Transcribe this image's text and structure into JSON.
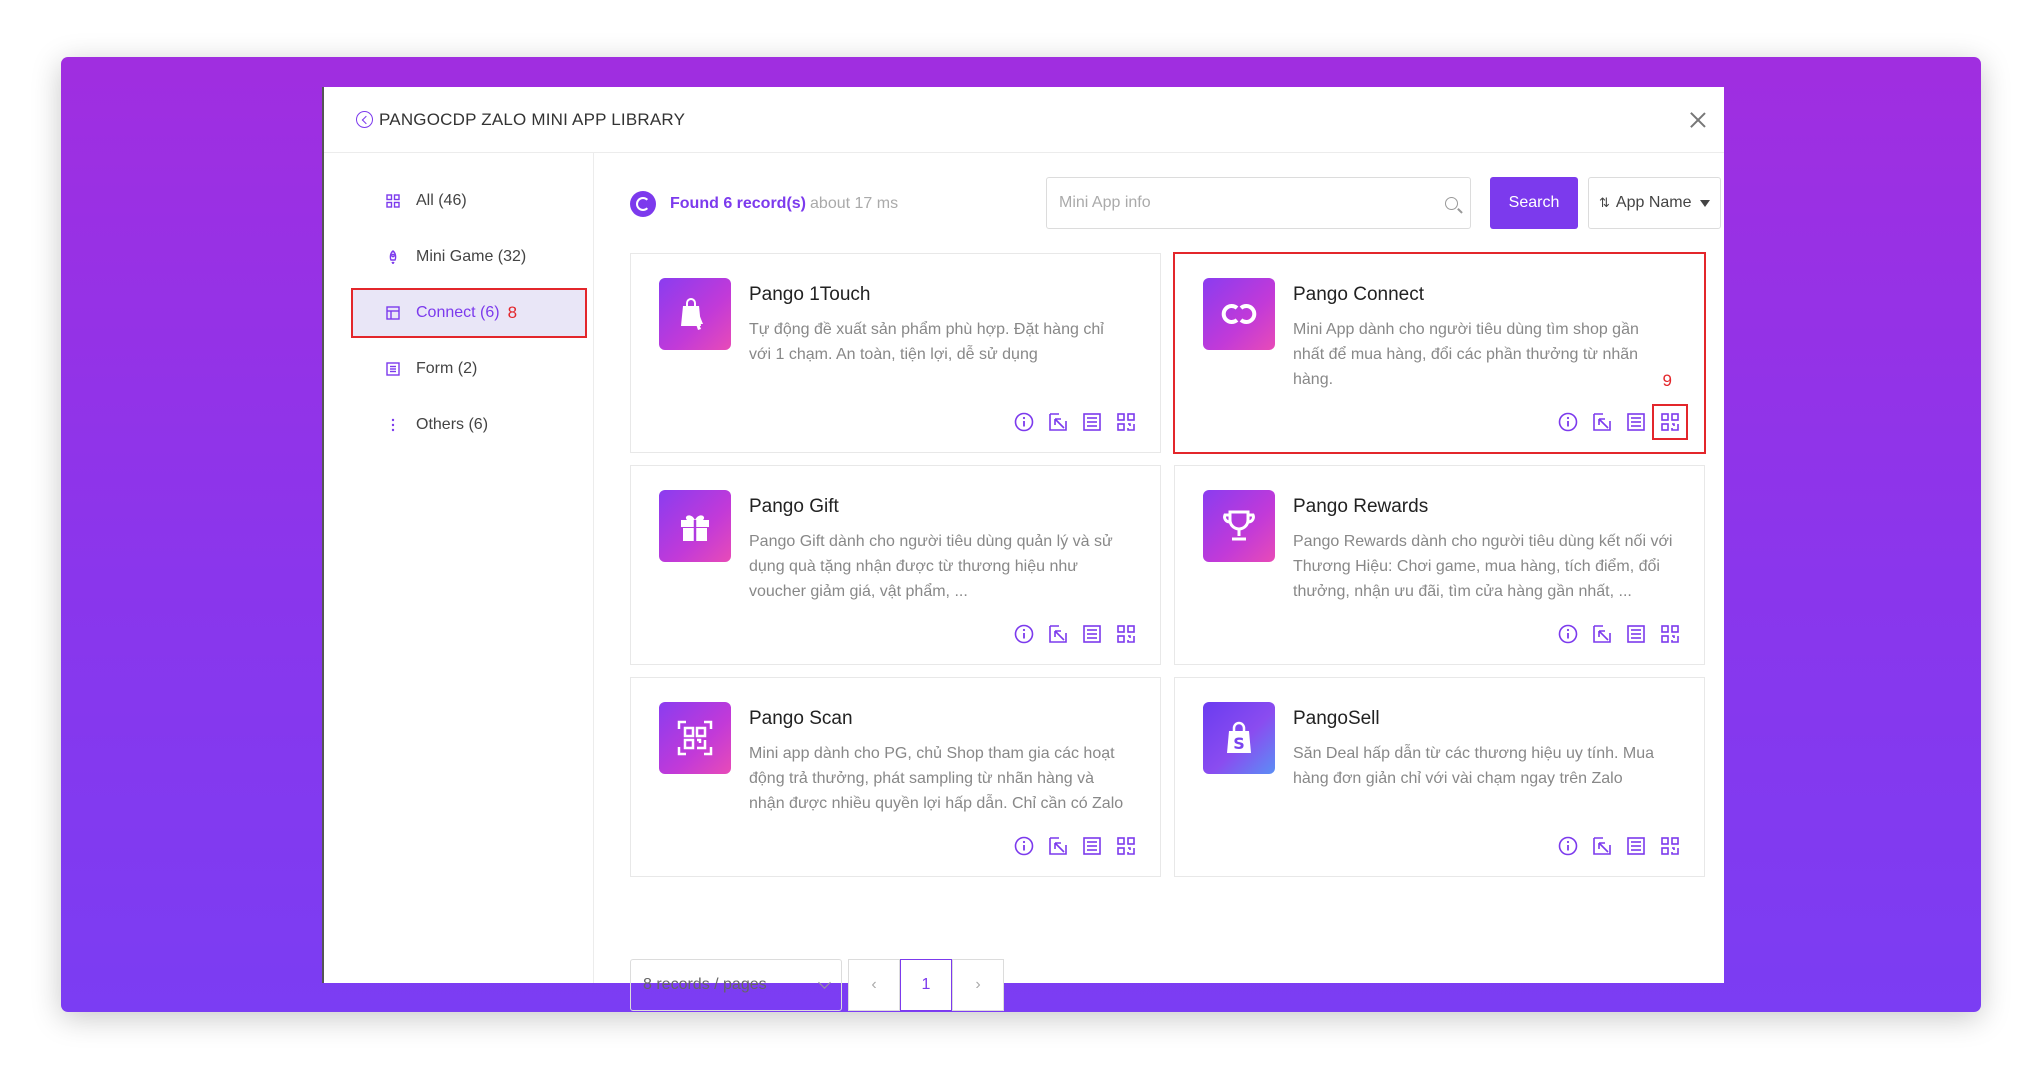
{
  "modal": {
    "title": "PANGOCDP ZALO MINI APP LIBRARY"
  },
  "sidebar": {
    "items": [
      {
        "label": "All (46)",
        "icon": "grid-icon"
      },
      {
        "label": "Mini Game (32)",
        "icon": "rocket-icon"
      },
      {
        "label": "Connect (6)",
        "icon": "connect-icon",
        "active": true,
        "marker": "8"
      },
      {
        "label": "Form (2)",
        "icon": "form-icon"
      },
      {
        "label": "Others (6)",
        "icon": "more-icon"
      }
    ]
  },
  "toolbar": {
    "found_strong": "Found 6 record(s)",
    "found_time": "about 17 ms",
    "search_placeholder": "Mini App info",
    "search_label": "Search",
    "sort_label": "App Name"
  },
  "apps": [
    {
      "title": "Pango 1Touch",
      "desc": "Tự động đề xuất sản phẩm phù hợp. Đặt hàng chỉ với 1 chạm. An toàn, tiện lợi, dễ sử dụng",
      "icon": "touch-bag-icon"
    },
    {
      "title": "Pango Connect",
      "desc": "Mini App dành cho người tiêu dùng tìm shop gần nhất để mua hàng, đổi các phần thưởng từ nhãn hàng.",
      "icon": "link-icon",
      "highlight": true,
      "marker": "9"
    },
    {
      "title": "Pango Gift",
      "desc": "Pango Gift dành cho người tiêu dùng quản lý và sử dụng quà tặng nhận được từ thương hiệu như voucher giảm giá, vật phẩm, ...",
      "icon": "gift-icon"
    },
    {
      "title": "Pango Rewards",
      "desc": "Pango Rewards dành cho người tiêu dùng kết nối với Thương Hiệu: Chơi game, mua hàng, tích điểm, đổi thưởng, nhận ưu đãi, tìm cửa hàng gần nhất, ...",
      "icon": "trophy-icon"
    },
    {
      "title": "Pango Scan",
      "desc": "Mini app dành cho PG, chủ Shop tham gia các hoạt động trả thưởng, phát sampling từ nhãn hàng và nhận được nhiều quyền lợi hấp dẫn. Chỉ cần có Zalo",
      "icon": "scan-icon"
    },
    {
      "title": "PangoSell",
      "desc": "Săn Deal hấp dẫn từ các thương hiệu uy tính. Mua hàng đơn giản chỉ với vài chạm ngay trên Zalo",
      "icon": "sell-bag-icon"
    }
  ],
  "pagination": {
    "page_size": "8 records / pages",
    "current_page": "1"
  },
  "colors": {
    "accent": "#7c3aed",
    "marker": "#e3262b"
  }
}
